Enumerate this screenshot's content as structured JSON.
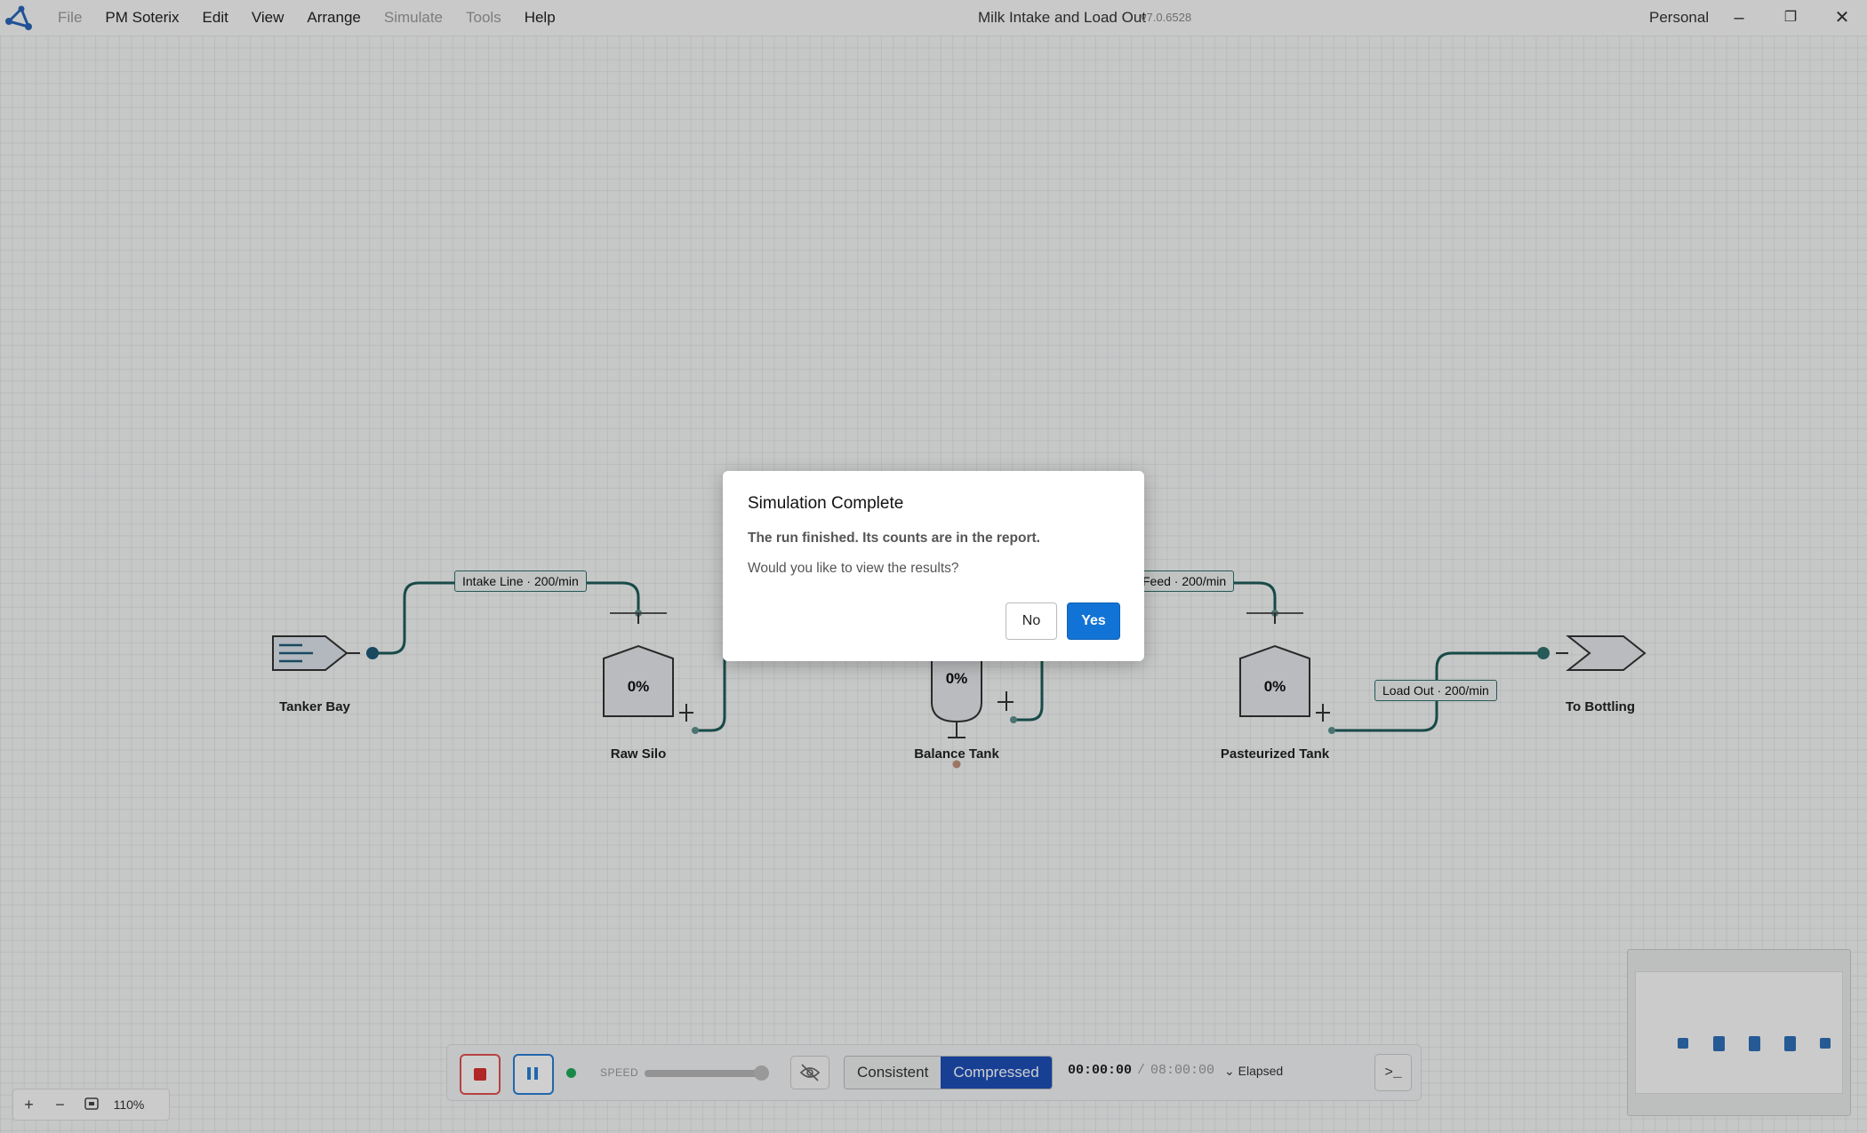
{
  "app": {
    "menu": [
      {
        "label": "File",
        "disabled": true
      },
      {
        "label": "PM Soterix",
        "disabled": false
      },
      {
        "label": "Edit",
        "disabled": false
      },
      {
        "label": "View",
        "disabled": false
      },
      {
        "label": "Arrange",
        "disabled": false
      },
      {
        "label": "Simulate",
        "disabled": true
      },
      {
        "label": "Tools",
        "disabled": true
      },
      {
        "label": "Help",
        "disabled": false
      }
    ],
    "window_title": "Milk Intake and Load Out",
    "version": "v7.0.6528",
    "account": "Personal"
  },
  "diagram": {
    "nodes": {
      "tanker_bay": "Tanker Bay",
      "raw_silo": "Raw Silo",
      "balance_tank": "Balance Tank",
      "pasteurized_tank": "Pasteurized Tank",
      "to_bottling": "To Bottling"
    },
    "fill_levels": {
      "raw_silo": "0%",
      "balance_tank": "0%",
      "pasteurized_tank": "0%"
    },
    "links": {
      "intake_line": "Intake Line · 200/min",
      "feed": "Feed · 200/min",
      "load_out": "Load Out · 200/min"
    }
  },
  "zoom": {
    "level": "110%"
  },
  "sim_controls": {
    "speed_label": "SPEED",
    "speed_value": 0.95,
    "modes": [
      "Consistent",
      "Compressed"
    ],
    "active_mode": "Compressed",
    "elapsed_current": "00:00:00",
    "elapsed_separator": "/",
    "elapsed_total": "08:00:00",
    "elapsed_mode": "Elapsed",
    "console_glyph": ">_"
  },
  "dialog": {
    "title": "Simulation Complete",
    "message_1": "The run finished. Its counts are in the report.",
    "message_2": "Would you like to view the results?",
    "no_label": "No",
    "yes_label": "Yes"
  },
  "colors": {
    "link": "#1d5c58",
    "node_fill": "#e6e9ec",
    "node_stroke": "#333333",
    "accent": "#1273d6",
    "active_mode": "#1d4fb8"
  }
}
